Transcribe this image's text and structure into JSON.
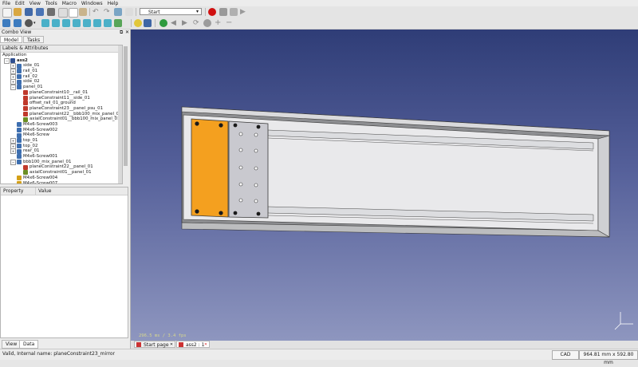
{
  "menu": [
    "File",
    "Edit",
    "View",
    "Tools",
    "Macro",
    "Windows",
    "Help"
  ],
  "workbench": "Start",
  "combo": {
    "title": "Combo View",
    "tabs": [
      "Model",
      "Tasks"
    ],
    "labels_header": "Labels & Attributes",
    "tree": [
      {
        "label": "Application",
        "indent": 0,
        "icon": "none",
        "expander": ""
      },
      {
        "label": "ass2",
        "indent": 1,
        "icon": "assembly",
        "expander": "−",
        "bold": true
      },
      {
        "label": "side_01",
        "indent": 2,
        "icon": "part",
        "expander": "+"
      },
      {
        "label": "rail_01",
        "indent": 2,
        "icon": "part",
        "expander": "+"
      },
      {
        "label": "rail_02",
        "indent": 2,
        "icon": "part",
        "expander": "+"
      },
      {
        "label": "side_02",
        "indent": 2,
        "icon": "part",
        "expander": "+"
      },
      {
        "label": "panel_01",
        "indent": 2,
        "icon": "part",
        "expander": "−"
      },
      {
        "label": "planeConstraint10__rail_01",
        "indent": 3,
        "icon": "constraint",
        "expander": ""
      },
      {
        "label": "planeConstraint11__side_01",
        "indent": 3,
        "icon": "constraint",
        "expander": ""
      },
      {
        "label": "offset_rail_01_ground",
        "indent": 3,
        "icon": "constraint",
        "expander": ""
      },
      {
        "label": "planeConstraint23__panel_psu_01",
        "indent": 3,
        "icon": "constraint",
        "expander": ""
      },
      {
        "label": "planeConstraint22__bbb100_mix_panel_01",
        "indent": 3,
        "icon": "constraint",
        "expander": ""
      },
      {
        "label": "axialConstraint01__bbb100_mix_panel_01",
        "indent": 3,
        "icon": "axial",
        "expander": ""
      },
      {
        "label": "M4x6-Screw003",
        "indent": 2,
        "icon": "part",
        "expander": ""
      },
      {
        "label": "M4x6-Screw002",
        "indent": 2,
        "icon": "part",
        "expander": ""
      },
      {
        "label": "M4x6-Screw",
        "indent": 2,
        "icon": "part",
        "expander": ""
      },
      {
        "label": "top_01",
        "indent": 2,
        "icon": "part",
        "expander": "+"
      },
      {
        "label": "top_02",
        "indent": 2,
        "icon": "part",
        "expander": "+"
      },
      {
        "label": "rear_01",
        "indent": 2,
        "icon": "part",
        "expander": "+"
      },
      {
        "label": "M4x6-Screw001",
        "indent": 2,
        "icon": "part",
        "expander": ""
      },
      {
        "label": "bbb100_mix_panel_01",
        "indent": 2,
        "icon": "part",
        "expander": "−"
      },
      {
        "label": "planeConstraint22__panel_01",
        "indent": 3,
        "icon": "constraint",
        "expander": ""
      },
      {
        "label": "axialConstraint01__panel_01",
        "indent": 3,
        "icon": "axial",
        "expander": ""
      },
      {
        "label": "M4x6-Screw004",
        "indent": 2,
        "icon": "screw",
        "expander": ""
      },
      {
        "label": "M4x6-Screw007",
        "indent": 2,
        "icon": "screw",
        "expander": ""
      }
    ],
    "props_header": [
      "Property",
      "Value"
    ],
    "bottom_tabs": [
      "View",
      "Data"
    ]
  },
  "viewport": {
    "fps": "296.5 ms / 3.4 fps"
  },
  "doc_tabs": [
    "Start page",
    "ass2 : 1"
  ],
  "status": {
    "message": "Valid, Internal name: planeConstraint23_mirror",
    "nav": "CAD",
    "dims": "964.81 mm x 592.80 mm"
  },
  "colors": {
    "accent_orange": "#f4a01f",
    "panel_gray": "#c9c9cf",
    "record": "#d01010"
  }
}
